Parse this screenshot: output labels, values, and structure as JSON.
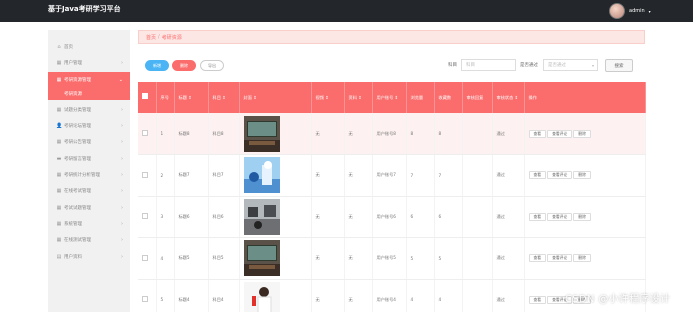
{
  "app": {
    "title": "基于Java考研学习平台",
    "username": "admin"
  },
  "sidebar": {
    "items": [
      {
        "label": "首页",
        "icon": "home-icon",
        "glyph": "⌂",
        "chevron": false,
        "active": false
      },
      {
        "label": "用户管理",
        "icon": "grid-icon",
        "glyph": "▦",
        "chevron": true,
        "active": false
      },
      {
        "label": "考研资源管理",
        "icon": "grid-icon",
        "glyph": "▦",
        "chevron": true,
        "active": true
      },
      {
        "label": "试题分类管理",
        "icon": "grid-icon",
        "glyph": "▦",
        "chevron": true,
        "active": false
      },
      {
        "label": "考研论坛管理",
        "icon": "user-icon",
        "glyph": "👤",
        "chevron": true,
        "active": false
      },
      {
        "label": "考研公告管理",
        "icon": "grid-icon",
        "glyph": "▦",
        "chevron": true,
        "active": false
      },
      {
        "label": "考研留言管理",
        "icon": "chat-icon",
        "glyph": "▬",
        "chevron": true,
        "active": false
      },
      {
        "label": "考研统计分析管理",
        "icon": "grid-icon",
        "glyph": "▦",
        "chevron": true,
        "active": false
      },
      {
        "label": "在线考试管理",
        "icon": "grid-icon",
        "glyph": "▦",
        "chevron": true,
        "active": false
      },
      {
        "label": "考试试题管理",
        "icon": "grid-icon",
        "glyph": "▦",
        "chevron": true,
        "active": false
      },
      {
        "label": "系统管理",
        "icon": "grid-icon",
        "glyph": "▦",
        "chevron": true,
        "active": false
      },
      {
        "label": "在线测试管理",
        "icon": "grid-icon",
        "glyph": "▦",
        "chevron": true,
        "active": false
      },
      {
        "label": "用户资料",
        "icon": "doc-icon",
        "glyph": "▤",
        "chevron": true,
        "active": false
      }
    ],
    "active_sub": "考研资源"
  },
  "breadcrumb": {
    "home": "首页",
    "separator": "/",
    "current": "考研资源"
  },
  "toolbar": {
    "add_label": "新增",
    "delete_label": "删除",
    "export_label": "导出"
  },
  "filters": {
    "subject_label": "科目",
    "subject_placeholder": "科目",
    "approval_label": "是否通过",
    "approval_placeholder": "是否通过",
    "search_label": "搜索"
  },
  "table": {
    "headers": [
      "序号",
      "标题 ⇕",
      "科目 ⇕",
      "封面 ⇕",
      "视频 ⇕",
      "资料 ⇕",
      "用户账号 ⇕",
      "浏览量",
      "收藏数",
      "审核回复",
      "审核状态 ⇕",
      "操作"
    ],
    "actions": {
      "view": "查看",
      "view_comments": "查看评论",
      "delete": "删除"
    },
    "rows": [
      {
        "index": "1",
        "title": "标题8",
        "subject": "科目8",
        "cover": "classroom",
        "video": "无",
        "material": "无",
        "account": "用户账号8",
        "views": "8",
        "favorites": "8",
        "reply": "",
        "status": "通过"
      },
      {
        "index": "2",
        "title": "标题7",
        "subject": "科目7",
        "cover": "blue-scene",
        "video": "无",
        "material": "无",
        "account": "用户账号7",
        "views": "7",
        "favorites": "7",
        "reply": "",
        "status": "通过"
      },
      {
        "index": "3",
        "title": "标题6",
        "subject": "科目6",
        "cover": "office",
        "video": "无",
        "material": "无",
        "account": "用户账号6",
        "views": "6",
        "favorites": "6",
        "reply": "",
        "status": "通过"
      },
      {
        "index": "4",
        "title": "标题5",
        "subject": "科目5",
        "cover": "classroom",
        "video": "无",
        "material": "无",
        "account": "用户账号5",
        "views": "5",
        "favorites": "5",
        "reply": "",
        "status": "通过"
      },
      {
        "index": "5",
        "title": "标题4",
        "subject": "科目4",
        "cover": "lab",
        "video": "无",
        "material": "无",
        "account": "用户账号4",
        "views": "4",
        "favorites": "4",
        "reply": "",
        "status": "通过"
      }
    ]
  },
  "watermark": "CSDN @小许程序设计",
  "colors": {
    "accent": "#fb6c6c",
    "topbar": "#23262b",
    "add_button": "#4ab4f5",
    "sidebar_bg": "#f1f1f1"
  }
}
